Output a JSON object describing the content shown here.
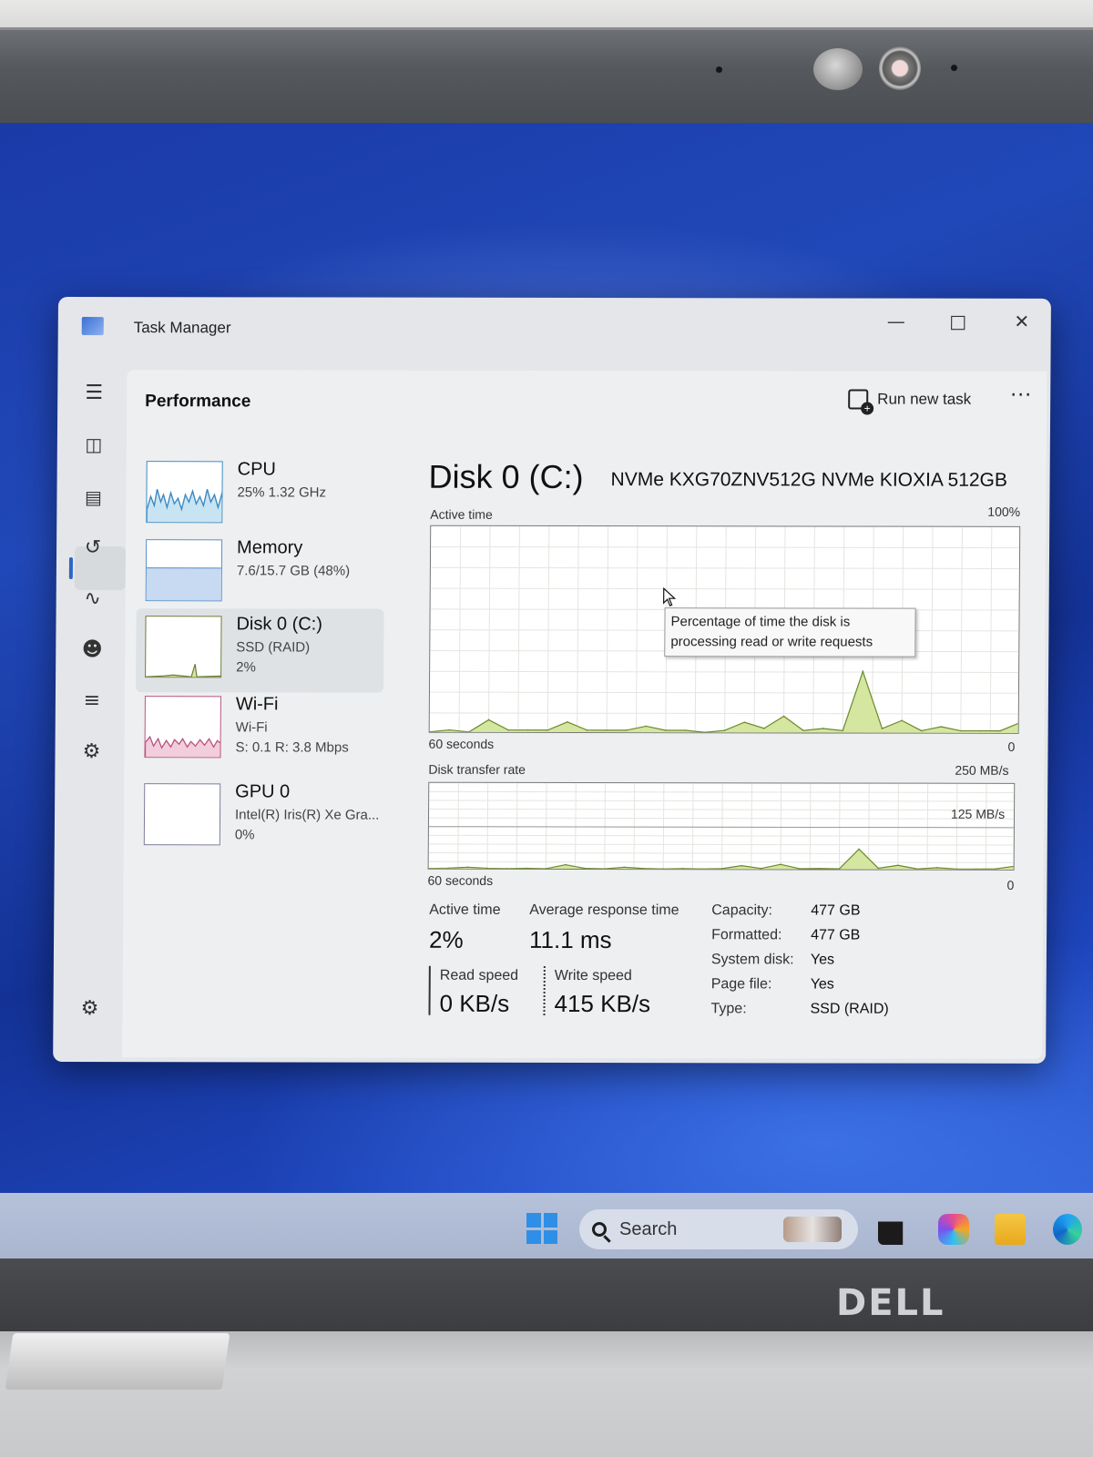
{
  "window": {
    "title": "Task Manager"
  },
  "page": {
    "title": "Performance",
    "run_new_task": "Run new task",
    "more": "···"
  },
  "devices": [
    {
      "name": "CPU",
      "line1": "25%  1.32 GHz",
      "line2": ""
    },
    {
      "name": "Memory",
      "line1": "7.6/15.7 GB (48%)",
      "line2": ""
    },
    {
      "name": "Disk 0 (C:)",
      "line1": "SSD (RAID)",
      "line2": "2%"
    },
    {
      "name": "Wi-Fi",
      "line1": "Wi-Fi",
      "line2": "S: 0.1  R: 3.8 Mbps"
    },
    {
      "name": "GPU 0",
      "line1": "Intel(R) Iris(R) Xe Gra...",
      "line2": "0%"
    }
  ],
  "detail": {
    "title": "Disk 0 (C:)",
    "model": "NVMe KXG70ZNV512G NVMe KIOXIA 512GB",
    "active_time_label": "Active time",
    "active_time_max": "100%",
    "time_span": "60 seconds",
    "zero": "0",
    "transfer_label": "Disk transfer rate",
    "transfer_max": "250 MB/s",
    "transfer_mid": "125 MB/s",
    "tooltip": "Percentage of time the disk is processing read or write requests",
    "stats": {
      "active_time_label": "Active time",
      "active_time_value": "2%",
      "avg_response_label": "Average response time",
      "avg_response_value": "11.1 ms",
      "read_label": "Read speed",
      "read_value": "0 KB/s",
      "write_label": "Write speed",
      "write_value": "415 KB/s"
    },
    "properties": [
      {
        "key": "Capacity:",
        "value": "477 GB"
      },
      {
        "key": "Formatted:",
        "value": "477 GB"
      },
      {
        "key": "System disk:",
        "value": "Yes"
      },
      {
        "key": "Page file:",
        "value": "Yes"
      },
      {
        "key": "Type:",
        "value": "SSD (RAID)"
      }
    ]
  },
  "chart_data": [
    {
      "type": "area",
      "title": "Active time",
      "ylabel": "%",
      "ylim": [
        0,
        100
      ],
      "x": [
        0,
        2,
        4,
        6,
        8,
        10,
        12,
        14,
        16,
        18,
        20,
        22,
        24,
        26,
        28,
        30,
        32,
        34,
        36,
        38,
        40,
        42,
        44,
        46,
        48,
        50,
        52,
        54,
        56,
        58,
        60
      ],
      "values": [
        0,
        1,
        0,
        6,
        1,
        1,
        1,
        5,
        1,
        1,
        1,
        3,
        1,
        1,
        0,
        1,
        5,
        2,
        8,
        1,
        2,
        1,
        30,
        2,
        6,
        1,
        3,
        1,
        1,
        1,
        5
      ]
    },
    {
      "type": "area",
      "title": "Disk transfer rate",
      "ylabel": "MB/s",
      "ylim": [
        0,
        250
      ],
      "x": [
        0,
        2,
        4,
        6,
        8,
        10,
        12,
        14,
        16,
        18,
        20,
        22,
        24,
        26,
        28,
        30,
        32,
        34,
        36,
        38,
        40,
        42,
        44,
        46,
        48,
        50,
        52,
        54,
        56,
        58,
        60
      ],
      "values": [
        0,
        1,
        4,
        1,
        0,
        1,
        0,
        12,
        1,
        0,
        5,
        1,
        0,
        1,
        0,
        1,
        10,
        2,
        14,
        1,
        2,
        1,
        60,
        3,
        12,
        1,
        5,
        1,
        1,
        2,
        10
      ]
    }
  ],
  "taskbar": {
    "search_text": "Search"
  },
  "brand": "DELL"
}
